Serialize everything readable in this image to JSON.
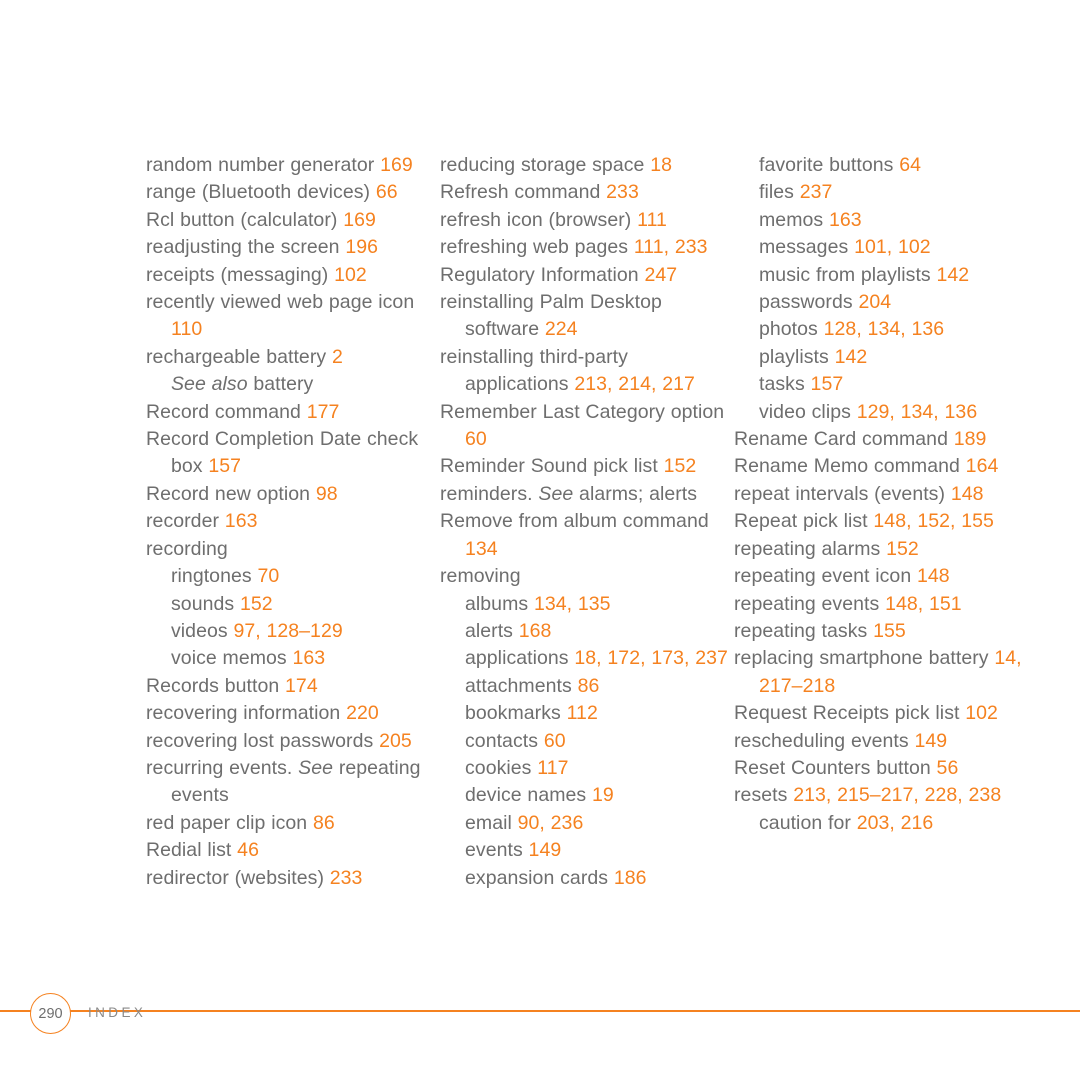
{
  "page": {
    "number": "290",
    "section_label": "INDEX",
    "accent_color": "#f58220",
    "text_color": "#6e6e6e",
    "background_color": "#ffffff"
  },
  "columns": [
    {
      "name": "column-1",
      "entries": [
        {
          "term": "random number generator",
          "pages": "169",
          "level": 0
        },
        {
          "term": "range (Bluetooth devices)",
          "pages": "66",
          "level": 0
        },
        {
          "term": "Rcl button (calculator)",
          "pages": "169",
          "level": 0
        },
        {
          "term": "readjusting the screen",
          "pages": "196",
          "level": 0
        },
        {
          "term": "receipts (messaging)",
          "pages": "102",
          "level": 0
        },
        {
          "term": "recently viewed web page icon",
          "pages": "110",
          "level": 0
        },
        {
          "term": "rechargeable battery",
          "pages": "2",
          "level": 0
        },
        {
          "term": "battery",
          "pages": "",
          "level": 1,
          "see_prefix": "See also"
        },
        {
          "term": "Record command",
          "pages": "177",
          "level": 0
        },
        {
          "term": "Record Completion Date check box",
          "pages": "157",
          "level": 0
        },
        {
          "term": "Record new option",
          "pages": "98",
          "level": 0
        },
        {
          "term": "recorder",
          "pages": "163",
          "level": 0
        },
        {
          "term": "recording",
          "pages": "",
          "level": 0
        },
        {
          "term": "ringtones",
          "pages": "70",
          "level": 1
        },
        {
          "term": "sounds",
          "pages": "152",
          "level": 1
        },
        {
          "term": "videos",
          "pages": "97, 128–129",
          "level": 1
        },
        {
          "term": "voice memos",
          "pages": "163",
          "level": 1
        },
        {
          "term": "Records button",
          "pages": "174",
          "level": 0
        },
        {
          "term": "recovering information",
          "pages": "220",
          "level": 0
        },
        {
          "term": "recovering lost passwords",
          "pages": "205",
          "level": 0
        },
        {
          "term": "recurring events.",
          "pages": "",
          "level": 0,
          "see_suffix": "See",
          "see_target": "repeating events"
        },
        {
          "term": "red paper clip icon",
          "pages": "86",
          "level": 0
        },
        {
          "term": "Redial list",
          "pages": "46",
          "level": 0
        },
        {
          "term": "redirector (websites)",
          "pages": "233",
          "level": 0
        }
      ]
    },
    {
      "name": "column-2",
      "entries": [
        {
          "term": "reducing storage space",
          "pages": "18",
          "level": 0
        },
        {
          "term": "Refresh command",
          "pages": "233",
          "level": 0
        },
        {
          "term": "refresh icon (browser)",
          "pages": "111",
          "level": 0
        },
        {
          "term": "refreshing web pages",
          "pages": "111, 233",
          "level": 0
        },
        {
          "term": "Regulatory Information",
          "pages": "247",
          "level": 0
        },
        {
          "term": "reinstalling Palm Desktop software",
          "pages": "224",
          "level": 0
        },
        {
          "term": "reinstalling third-party applications",
          "pages": "213, 214, 217",
          "level": 0
        },
        {
          "term": "Remember Last Category option",
          "pages": "60",
          "level": 0
        },
        {
          "term": "Reminder Sound pick list",
          "pages": "152",
          "level": 0
        },
        {
          "term": "reminders.",
          "pages": "",
          "level": 0,
          "see_suffix": "See",
          "see_target": "alarms; alerts",
          "see_inline": true
        },
        {
          "term": "Remove from album command",
          "pages": "134",
          "level": 0
        },
        {
          "term": "removing",
          "pages": "",
          "level": 0
        },
        {
          "term": "albums",
          "pages": "134, 135",
          "level": 1
        },
        {
          "term": "alerts",
          "pages": "168",
          "level": 1
        },
        {
          "term": "applications",
          "pages": "18, 172, 173, 237",
          "level": 1
        },
        {
          "term": "attachments",
          "pages": "86",
          "level": 1
        },
        {
          "term": "bookmarks",
          "pages": "112",
          "level": 1
        },
        {
          "term": "contacts",
          "pages": "60",
          "level": 1
        },
        {
          "term": "cookies",
          "pages": "117",
          "level": 1
        },
        {
          "term": "device names",
          "pages": "19",
          "level": 1
        },
        {
          "term": "email",
          "pages": "90, 236",
          "level": 1
        },
        {
          "term": "events",
          "pages": "149",
          "level": 1
        },
        {
          "term": "expansion cards",
          "pages": "186",
          "level": 1
        }
      ]
    },
    {
      "name": "column-3",
      "entries": [
        {
          "term": "favorite buttons",
          "pages": "64",
          "level": 1
        },
        {
          "term": "files",
          "pages": "237",
          "level": 1
        },
        {
          "term": "memos",
          "pages": "163",
          "level": 1
        },
        {
          "term": "messages",
          "pages": "101, 102",
          "level": 1
        },
        {
          "term": "music from playlists",
          "pages": "142",
          "level": 1
        },
        {
          "term": "passwords",
          "pages": "204",
          "level": 1
        },
        {
          "term": "photos",
          "pages": "128, 134, 136",
          "level": 1
        },
        {
          "term": "playlists",
          "pages": "142",
          "level": 1
        },
        {
          "term": "tasks",
          "pages": "157",
          "level": 1
        },
        {
          "term": "video clips",
          "pages": "129, 134, 136",
          "level": 1
        },
        {
          "term": "Rename Card command",
          "pages": "189",
          "level": 0
        },
        {
          "term": "Rename Memo command",
          "pages": "164",
          "level": 0
        },
        {
          "term": "repeat intervals (events)",
          "pages": "148",
          "level": 0
        },
        {
          "term": "Repeat pick list",
          "pages": "148, 152, 155",
          "level": 0
        },
        {
          "term": "repeating alarms",
          "pages": "152",
          "level": 0
        },
        {
          "term": "repeating event icon",
          "pages": "148",
          "level": 0
        },
        {
          "term": "repeating events",
          "pages": "148, 151",
          "level": 0
        },
        {
          "term": "repeating tasks",
          "pages": "155",
          "level": 0
        },
        {
          "term": "replacing smartphone battery",
          "pages": "14, 217–218",
          "level": 0
        },
        {
          "term": "Request Receipts pick list",
          "pages": "102",
          "level": 0
        },
        {
          "term": "rescheduling events",
          "pages": "149",
          "level": 0
        },
        {
          "term": "Reset Counters button",
          "pages": "56",
          "level": 0
        },
        {
          "term": "resets",
          "pages": "213, 215–217, 228, 238",
          "level": 0
        },
        {
          "term": "caution for",
          "pages": "203, 216",
          "level": 1
        }
      ]
    }
  ]
}
